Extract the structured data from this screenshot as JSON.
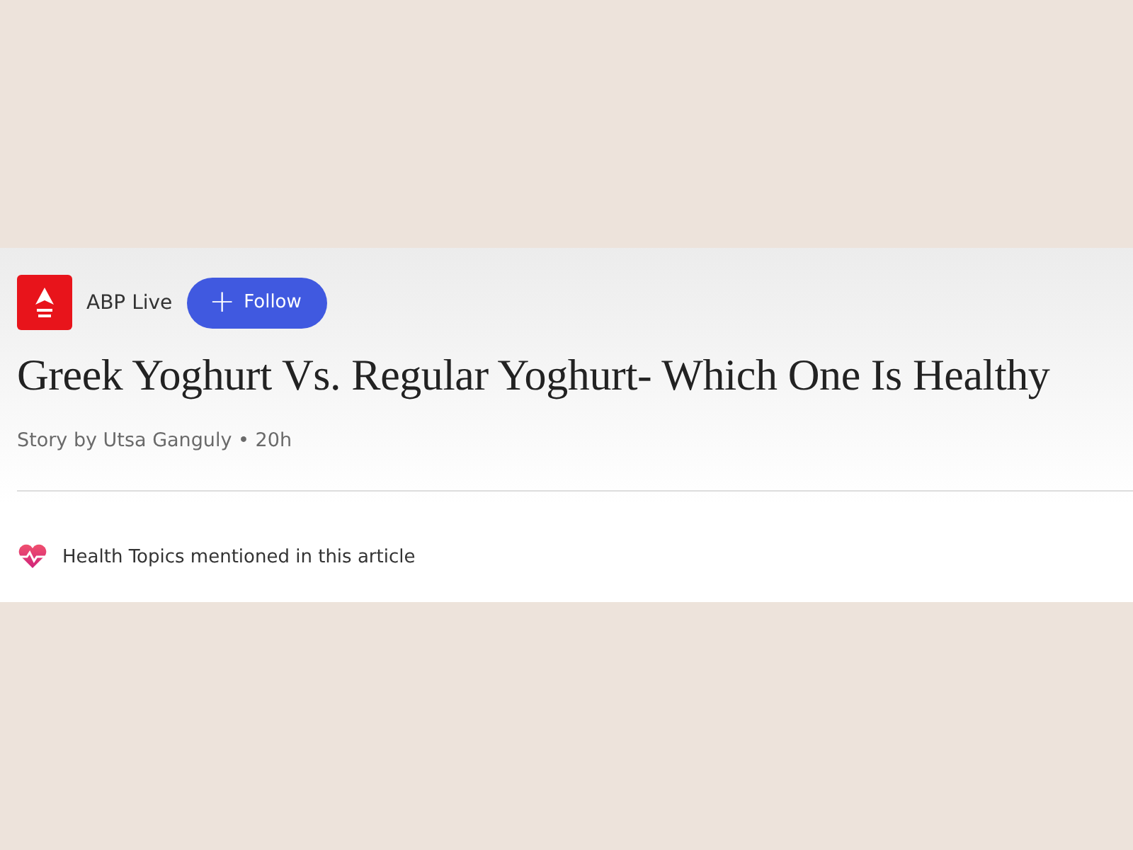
{
  "source": {
    "name": "ABP Live",
    "follow_button": {
      "icon": "+",
      "label": "Follow"
    }
  },
  "headline": "Greek Yoghurt Vs. Regular Yoghurt- Which One Is Healthy",
  "byline": "Story by Utsa Ganguly • 20h",
  "health_topics": {
    "label": "Health Topics mentioned in this article"
  }
}
